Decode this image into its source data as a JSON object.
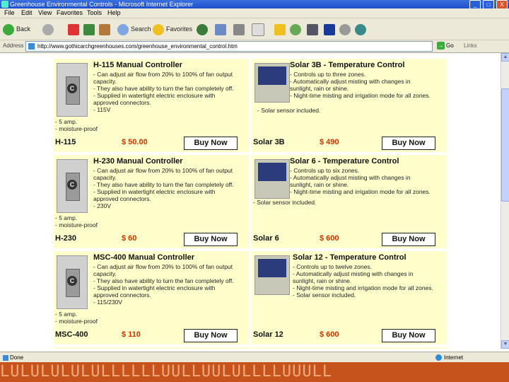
{
  "window": {
    "title": "Greenhouse Environmental Controls - Microsoft Internet Explorer",
    "buttons": [
      "_",
      "□",
      "X"
    ]
  },
  "menu": [
    "File",
    "Edit",
    "View",
    "Favorites",
    "Tools",
    "Help"
  ],
  "toolbar": {
    "back_label": "Back",
    "search_label": "Search",
    "favorites_label": "Favorites"
  },
  "address": {
    "label": "Address",
    "url": "http://www.gothicarchgreenhouses.com/greenhouse_environmental_control.htm",
    "go_label": "Go",
    "links_label": "Links"
  },
  "products": [
    {
      "title": "H-115 Manual Controller",
      "desc": [
        "- Can adjust air flow from 20% to 100% of fan output",
        "capacity.",
        "- They also have ability to turn the fan completely off.",
        "- Supplied in watertight electric enclosure with",
        "approved connectors.",
        "- 115V"
      ],
      "extra": [
        "- 5 amp.",
        "- moisture-proof"
      ],
      "model": "H-115",
      "price": "$ 50.00",
      "buy": "Buy Now"
    },
    {
      "title": "Solar 3B - Temperature Control",
      "desc": [
        "- Controls up to three zones.",
        "- Automatically adjust misting with changes in",
        "sunlight, rain or shine.",
        "- Night-time misting and irrigation mode for all zones.",
        "- Solar sensor included."
      ],
      "extra": [],
      "model": "Solar 3B",
      "price": "$ 490",
      "buy": "Buy Now"
    },
    {
      "title": "H-230 Manual Controller",
      "desc": [
        "- Can adjust air flow from 20% to 100% of fan output",
        "capacity.",
        "- They also have ability to turn the fan completely off.",
        "- Supplied in watertight electric enclosure with",
        "approved connectors.",
        "- 230V"
      ],
      "extra": [
        "- 5 amp.",
        "- moisture-proof"
      ],
      "model": "H-230",
      "price": "$ 60",
      "buy": "Buy Now"
    },
    {
      "title": "Solar 6 - Temperature Control",
      "desc": [
        "- Controls up to six zones.",
        "- Automatically adjust misting with changes in",
        "sunlight, rain or shine.",
        "- Night-time misting and irrigation mode for all zones.",
        "- Solar sensor included."
      ],
      "extra": [],
      "model": "Solar 6",
      "price": "$ 600",
      "buy": "Buy Now"
    },
    {
      "title": "MSC-400 Manual Controller",
      "desc": [
        "- Can adjust air flow from 20% to 100% of fan output",
        "capacity.",
        "- They also have ability to turn the fan completely off.",
        "- Supplied in watertight electric enclosure with",
        "approved connectors.",
        "- 115/230V"
      ],
      "extra": [
        "- 5 amp.",
        "- moisture-proof"
      ],
      "model": "MSC-400",
      "price": "$ 110",
      "buy": "Buy Now"
    },
    {
      "title": "Solar 12 - Temperature Control",
      "desc": [
        "- Controls up to twelve zones.",
        "- Automatically adjust misting with changes in",
        "sunlight, rain or shine.",
        "- Night-time misting and irrigation mode for all zones.",
        "- Solar sensor included."
      ],
      "extra": [],
      "model": "Solar 12",
      "price": "$ 600",
      "buy": "Buy Now"
    }
  ],
  "status": {
    "text": "Done",
    "zone": "Internet"
  },
  "decor": "LULULULULULLLLLLUULLUULULLLLUUULL"
}
